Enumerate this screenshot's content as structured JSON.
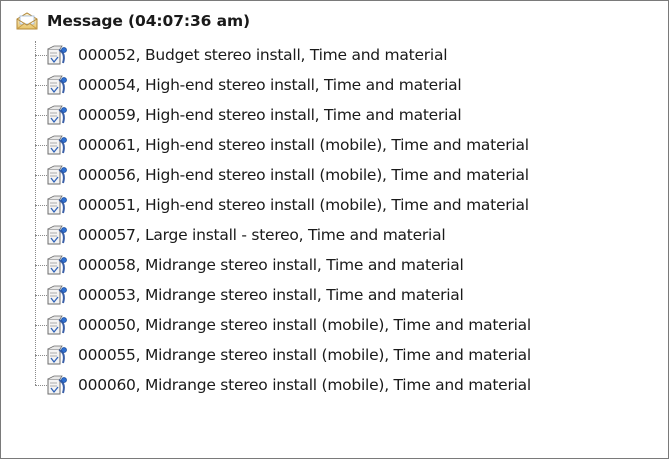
{
  "tree": {
    "root": {
      "icon": "envelope-icon",
      "label": "Message (04:07:36 am)"
    },
    "items": [
      {
        "icon": "document-info-icon",
        "label": "000052, Budget stereo install, Time and material"
      },
      {
        "icon": "document-info-icon",
        "label": "000054, High-end stereo install, Time and material"
      },
      {
        "icon": "document-info-icon",
        "label": "000059, High-end stereo install, Time and material"
      },
      {
        "icon": "document-info-icon",
        "label": "000061, High-end stereo install (mobile), Time and material"
      },
      {
        "icon": "document-info-icon",
        "label": "000056, High-end stereo install (mobile), Time and material"
      },
      {
        "icon": "document-info-icon",
        "label": "000051, High-end stereo install (mobile), Time and material"
      },
      {
        "icon": "document-info-icon",
        "label": "000057, Large install - stereo, Time and material"
      },
      {
        "icon": "document-info-icon",
        "label": "000058, Midrange stereo install, Time and material"
      },
      {
        "icon": "document-info-icon",
        "label": "000053, Midrange stereo install, Time and material"
      },
      {
        "icon": "document-info-icon",
        "label": "000050, Midrange stereo install (mobile), Time and material"
      },
      {
        "icon": "document-info-icon",
        "label": "000055, Midrange stereo install (mobile), Time and material"
      },
      {
        "icon": "document-info-icon",
        "label": "000060, Midrange stereo install (mobile), Time and material"
      }
    ]
  }
}
